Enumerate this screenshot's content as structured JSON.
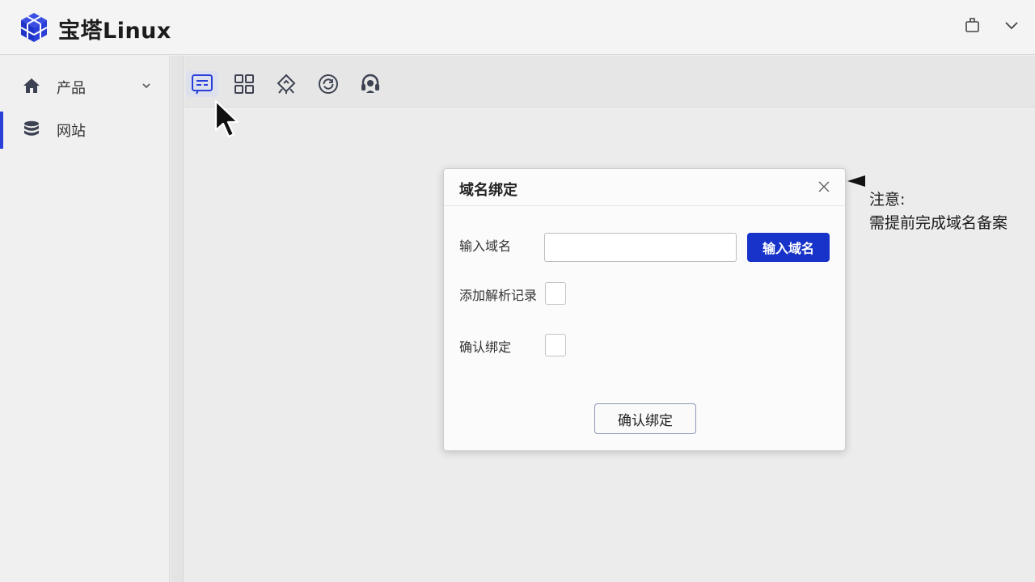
{
  "app": {
    "title": "宝塔Linux"
  },
  "colors": {
    "accent": "#1733c9",
    "active_indicator": "#2840d8"
  },
  "header": {
    "icons": [
      "window-icon",
      "chevron-down-icon"
    ]
  },
  "sidebar": {
    "items": [
      {
        "label": "产品",
        "icon": "home-icon",
        "expandable": true
      },
      {
        "label": "网站",
        "icon": "database-stack-icon",
        "active": true
      }
    ]
  },
  "toolbar": {
    "icons": [
      "domain-form-icon",
      "grid-icon",
      "deploy-icon",
      "refresh-circle-icon",
      "support-icon"
    ]
  },
  "dialog": {
    "title": "域名绑定",
    "domain_label": "输入域名",
    "domain_value": "",
    "domain_button": "输入域名",
    "dns_label": "添加解析记录",
    "confirm_label": "确认绑定",
    "confirm_button": "确认绑定"
  },
  "note": {
    "title": "注意:",
    "body": "需提前完成域名备案"
  }
}
